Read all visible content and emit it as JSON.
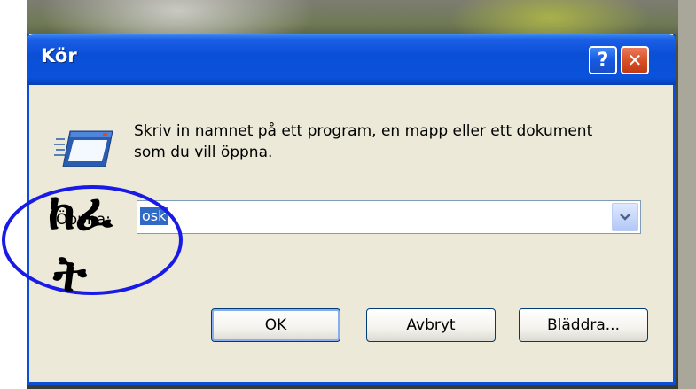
{
  "dialog": {
    "title": "Kör",
    "help_symbol": "?",
    "close_symbol": "✕",
    "icon": "run-program-icon",
    "instruction": "Skriv in namnet på ett program, en mapp eller ett dokument som du vill öppna.",
    "open_label": "Öppna:",
    "open_value": "osk",
    "buttons": {
      "ok": "OK",
      "cancel": "Avbryt",
      "browse": "Bläddra..."
    }
  },
  "annotation": {
    "glyph_line1": "ከፈ",
    "glyph_line2": "ት",
    "circle_color": "#1a1ae6"
  },
  "colors": {
    "titlebar": "#0a4fd6",
    "dialog_bg": "#ece9d8",
    "selection": "#316ac5",
    "close_button": "#d95128"
  }
}
